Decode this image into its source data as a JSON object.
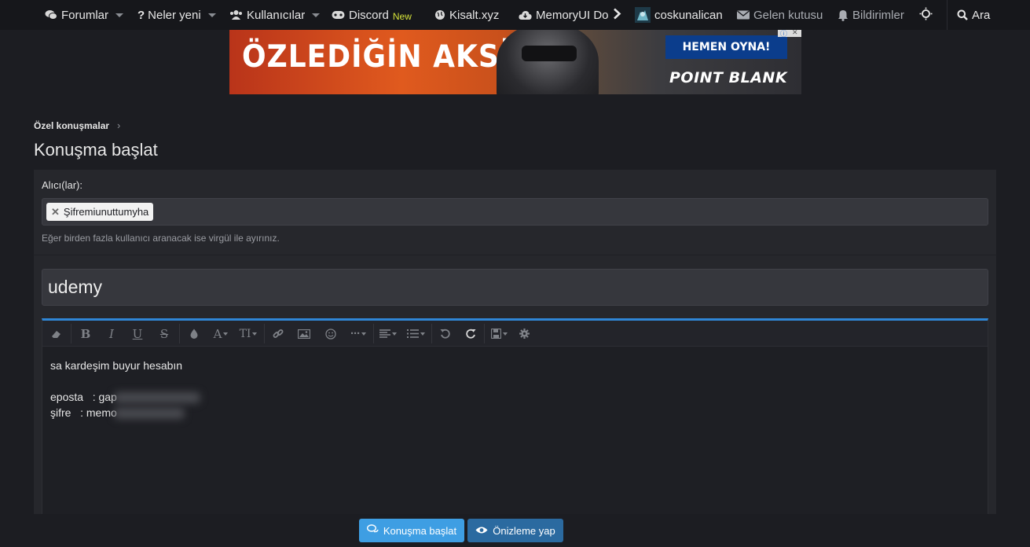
{
  "nav": {
    "forums": "Forumlar",
    "whats_new": "Neler yeni",
    "members": "Kullanıcılar",
    "discord": "Discord",
    "discord_badge": "New",
    "kisalt": "Kisalt.xyz",
    "memoryui": "MemoryUI Do",
    "username": "coskunalican",
    "inbox": "Gelen kutusu",
    "alerts": "Bildirimler",
    "search": "Ara"
  },
  "ad": {
    "slogan": "ÖZLEDİĞİN AKSİYON!",
    "cta": "HEMEN OYNA!",
    "brand": "POINT BLANK"
  },
  "breadcrumb": {
    "item": "Özel konuşmalar"
  },
  "page_title": "Konuşma başlat",
  "form": {
    "recipients_label": "Alıcı(lar):",
    "recipient_token": "Şifremiunuttumyha",
    "recipients_hint": "Eğer birden fazla kullanıcı aranacak ise virgül ile ayırınız.",
    "title_value": "udemy",
    "message_lines": [
      "sa kardeşim buyur hesabın",
      "",
      "eposta   : gap",
      "şifre   : memo"
    ]
  },
  "buttons": {
    "start": "Konuşma başlat",
    "preview": "Önizleme yap"
  },
  "colors": {
    "background": "#1c1d22",
    "panel": "#26272c",
    "accent": "#2f86d6",
    "primary_button": "#3e9ee3",
    "secondary_button": "#2b6aa0",
    "new_badge": "#d6e33a"
  }
}
